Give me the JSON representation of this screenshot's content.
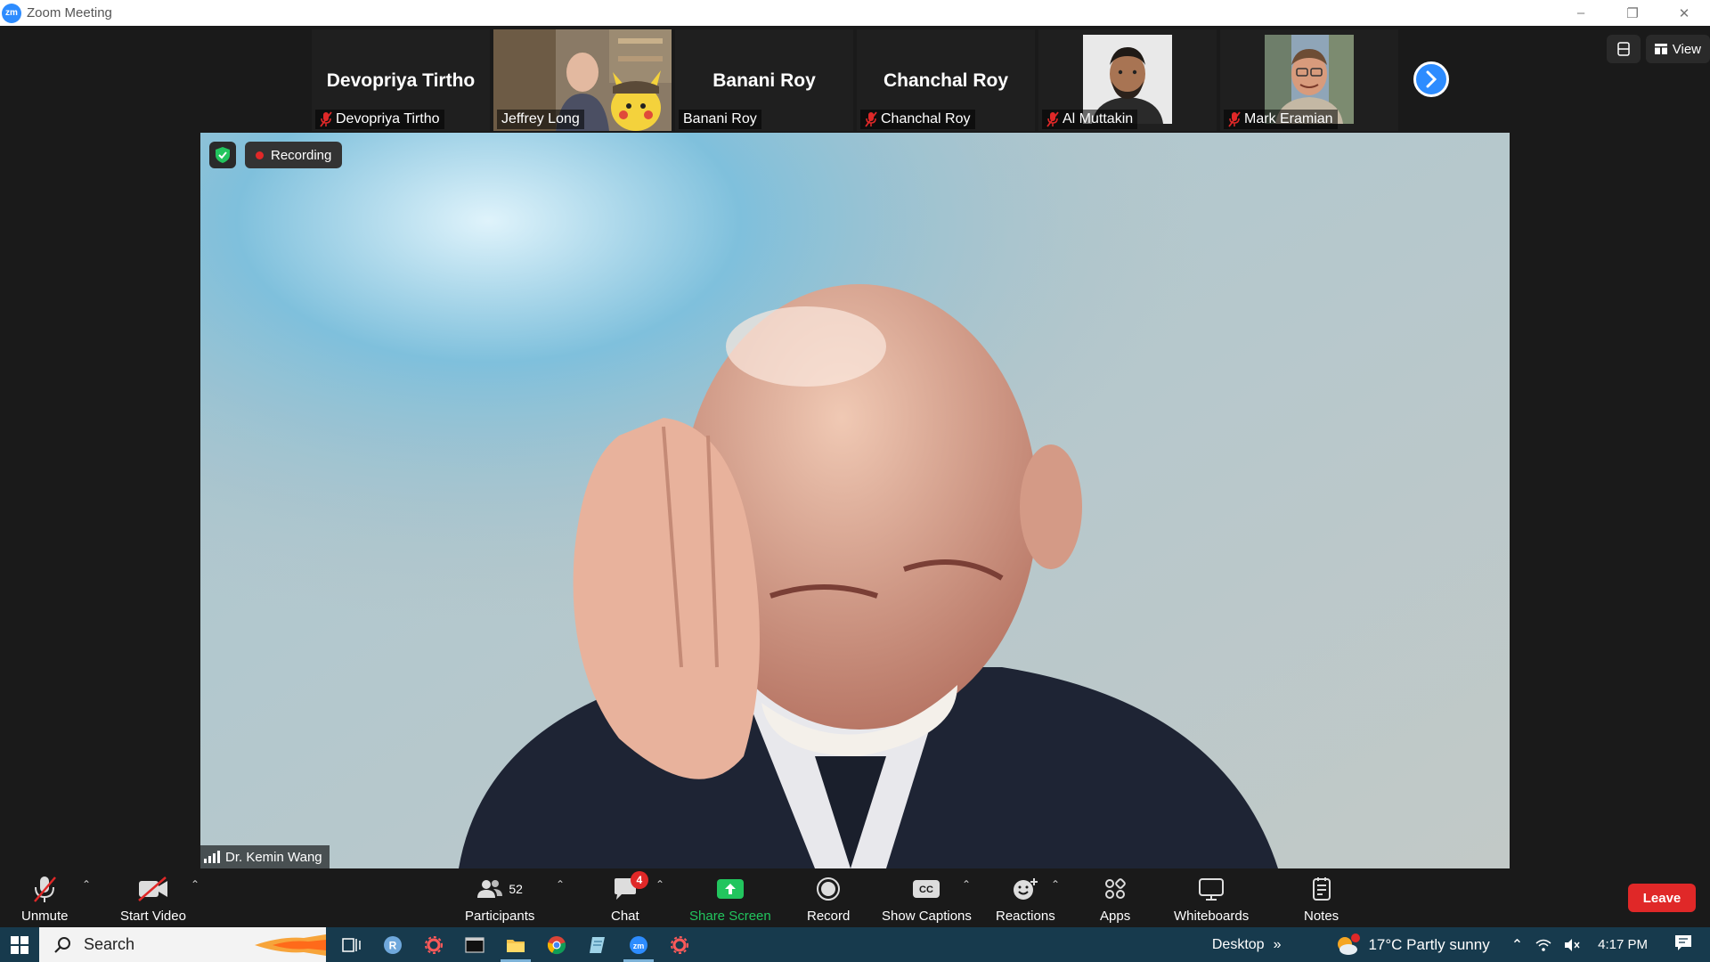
{
  "window": {
    "title": "Zoom Meeting",
    "app_icon": "zm"
  },
  "gallery": [
    {
      "big_name": "Devopriya Tirtho",
      "label": "Devopriya Tirtho",
      "muted": true,
      "video": false
    },
    {
      "big_name": "",
      "label": "Jeffrey Long",
      "muted": false,
      "video": true
    },
    {
      "big_name": "Banani Roy",
      "label": "Banani Roy",
      "muted": false,
      "video": false
    },
    {
      "big_name": "Chanchal Roy",
      "label": "Chanchal Roy",
      "muted": true,
      "video": false
    },
    {
      "big_name": "",
      "label": "Al Muttakin",
      "muted": true,
      "video": true
    },
    {
      "big_name": "",
      "label": "Mark Eramian",
      "muted": true,
      "video": true
    }
  ],
  "top_right": {
    "view_label": "View"
  },
  "main": {
    "recording_label": "Recording",
    "speaker_name": "Dr. Kemin Wang"
  },
  "toolbar": {
    "unmute": "Unmute",
    "start_video": "Start Video",
    "participants": "Participants",
    "participants_count": "52",
    "chat": "Chat",
    "chat_badge": "4",
    "share_screen": "Share Screen",
    "record": "Record",
    "show_captions": "Show Captions",
    "reactions": "Reactions",
    "apps": "Apps",
    "whiteboards": "Whiteboards",
    "notes": "Notes",
    "leave": "Leave"
  },
  "taskbar": {
    "search_label": "Search",
    "desktop_label": "Desktop",
    "weather": "17°C Partly sunny",
    "weather_badge": "1",
    "time": "4:17 PM"
  },
  "colors": {
    "accent": "#2d8cff",
    "leave": "#e02828",
    "share": "#22c55e",
    "taskbar": "#173a4d"
  }
}
